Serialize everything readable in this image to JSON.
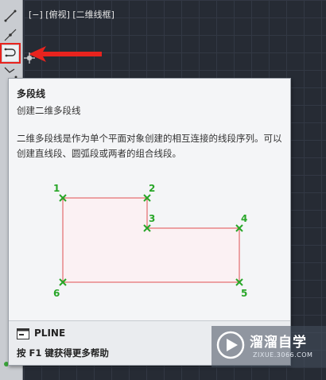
{
  "viewport": {
    "label": "[−] [俯视] [二维线框]"
  },
  "tooltip": {
    "title": "多段线",
    "subtitle": "创建二维多段线",
    "description": "二维多段线是作为单个平面对象创建的相互连接的线段序列。可以创建直线段、圆弧段或两者的组合线段。",
    "diagram_points": [
      "1",
      "2",
      "3",
      "4",
      "5",
      "6"
    ],
    "command": "PLINE",
    "help": "按 F1 键获得更多帮助"
  },
  "watermark": {
    "name": "溜溜自学",
    "url": "ZIXUE.3066.COM"
  },
  "colors": {
    "highlight": "#e8231e",
    "point": "#28a628",
    "polyline": "#e05050"
  },
  "icons": {
    "toolbar": [
      "line-icon",
      "construction-line-icon",
      "polyline-icon",
      "spline-fit-icon"
    ]
  }
}
